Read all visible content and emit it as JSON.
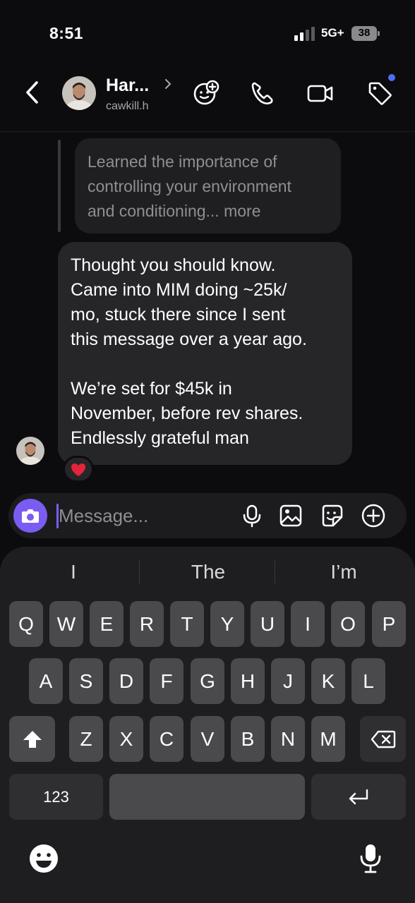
{
  "status_bar": {
    "time": "8:51",
    "network": "5G+",
    "battery": "38"
  },
  "header": {
    "name": "Har...",
    "username": "cawkill.h"
  },
  "reply_preview": {
    "lines": [
      "Learned the importance of",
      "controlling your environment",
      "and conditioning... more"
    ]
  },
  "message": {
    "paragraph1": [
      "Thought you should know.",
      "Came into MIM doing ~25k/",
      "mo, stuck there since I sent",
      "this message over a year ago."
    ],
    "paragraph2": [
      "We’re set for $45k in",
      "November, before rev shares.",
      "Endlessly grateful man"
    ],
    "reaction": "❤️"
  },
  "composer": {
    "placeholder": "Message..."
  },
  "keyboard": {
    "suggestions": [
      "I",
      "The",
      "I’m"
    ],
    "row1": [
      "Q",
      "W",
      "E",
      "R",
      "T",
      "Y",
      "U",
      "I",
      "O",
      "P"
    ],
    "row2": [
      "A",
      "S",
      "D",
      "F",
      "G",
      "H",
      "J",
      "K",
      "L"
    ],
    "row3": [
      "Z",
      "X",
      "C",
      "V",
      "B",
      "N",
      "M"
    ],
    "numbers_label": "123"
  },
  "colors": {
    "accent": "#7b5cf3",
    "notification_dot": "#4e6ef2",
    "bubble": "#262629",
    "reaction_heart": "#e5243b"
  }
}
